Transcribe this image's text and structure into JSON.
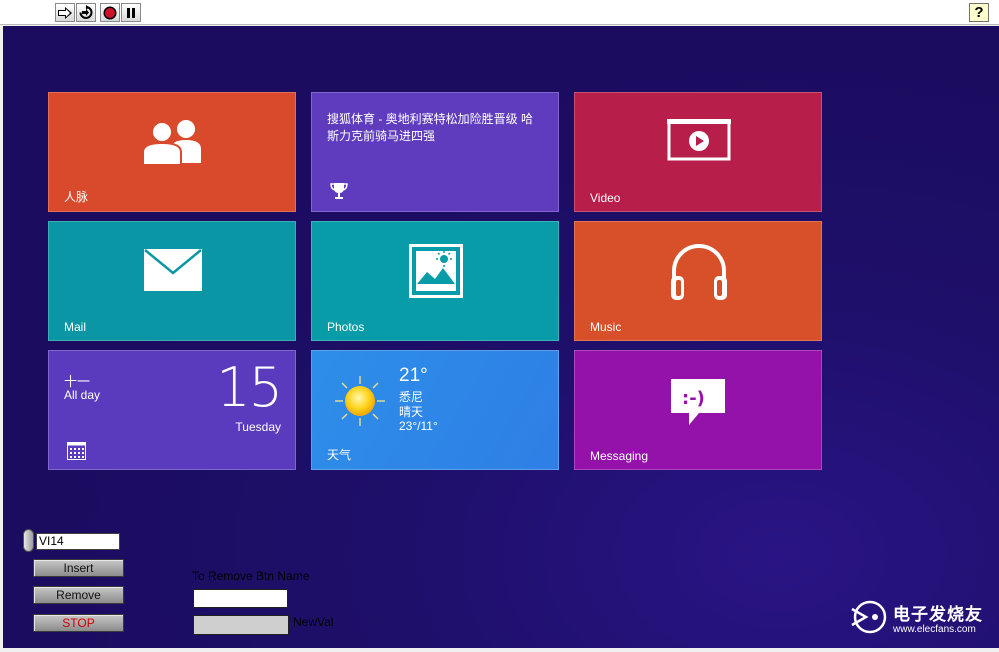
{
  "toolbar": {
    "buttons": [
      "run-arrow-icon",
      "run-continuous-icon",
      "abort-icon",
      "pause-icon"
    ],
    "help_label": "?"
  },
  "tiles": {
    "contacts": {
      "label": "人脉",
      "color": "#d9492c"
    },
    "news": {
      "text": "搜狐体育 - 奥地利赛特松加险胜晋级 哈斯力克前骑马进四强",
      "color": "#5f3cbe"
    },
    "video": {
      "label": "Video",
      "color": "#b71f4a"
    },
    "mail": {
      "label": "Mail",
      "color": "#0a96a5"
    },
    "photos": {
      "label": "Photos",
      "color": "#089ca8"
    },
    "music": {
      "label": "Music",
      "color": "#d7502a"
    },
    "calendar": {
      "weekday": "十一",
      "allday": "All day",
      "date": "15",
      "day": "Tuesday",
      "color": "#5a3bbd"
    },
    "weather": {
      "temp": "21°",
      "city": "悉尼",
      "condition": "晴天",
      "range": "23°/11°",
      "label": "天气",
      "color": "#2d8ee8"
    },
    "messaging": {
      "label": "Messaging",
      "color": "#9412aa"
    }
  },
  "controls": {
    "ring_value": "VI14",
    "insert_label": "Insert",
    "remove_label": "Remove",
    "stop_label": "STOP",
    "remove_btn_name_label": "To Remove Btn Name",
    "remove_btn_name_value": "",
    "newval_label": "NewVal",
    "newval_value": ""
  },
  "watermark": {
    "cn": "电子发烧友",
    "url": "www.elecfans.com"
  }
}
